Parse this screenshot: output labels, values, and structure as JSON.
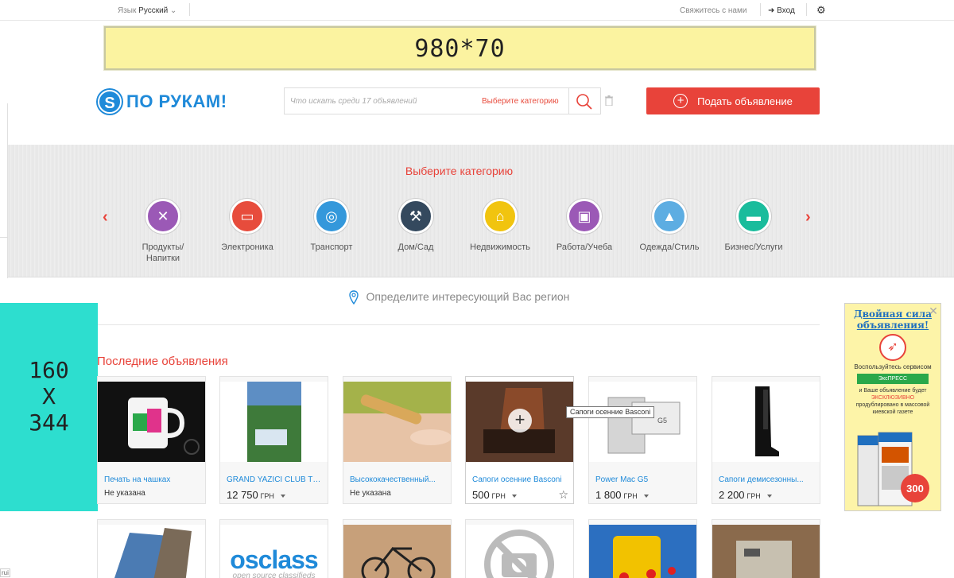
{
  "topbar": {
    "lang_label": "Язык",
    "lang_value": "Русский",
    "contact": "Свяжитесь с нами",
    "login": "Вход"
  },
  "banner_top": {
    "text": "980*70"
  },
  "header": {
    "logo_text": "ПО РУКАМ!",
    "logo_letter": "S",
    "search_placeholder": "Что искать среди 17 объявлений",
    "search_category": "Выберите категорию",
    "post_button": "Подать объявление",
    "accent": "#e8433a",
    "brand": "#1f8ad9"
  },
  "categories": {
    "title": "Выберите категорию",
    "items": [
      {
        "label": "Продукты/ Напитки",
        "color": "#9b59b6",
        "icon": "fork-knife-icon",
        "glyph": "✕"
      },
      {
        "label": "Электроника",
        "color": "#e74c3c",
        "icon": "monitor-icon",
        "glyph": "▭"
      },
      {
        "label": "Транспорт",
        "color": "#3498db",
        "icon": "wheel-icon",
        "glyph": "◎"
      },
      {
        "label": "Дом/Сад",
        "color": "#34495e",
        "icon": "tools-icon",
        "glyph": "⚒"
      },
      {
        "label": "Недвижимость",
        "color": "#f1c40f",
        "icon": "house-icon",
        "glyph": "⌂"
      },
      {
        "label": "Работа/Учеба",
        "color": "#9b59b6",
        "icon": "briefcase-icon",
        "glyph": "▣"
      },
      {
        "label": "Одежда/Стиль",
        "color": "#5dade2",
        "icon": "hanger-icon",
        "glyph": "▲"
      },
      {
        "label": "Бизнес/Услуги",
        "color": "#1abc9c",
        "icon": "card-icon",
        "glyph": "▬"
      }
    ]
  },
  "region": {
    "text": "Определите интересующий Вас регион"
  },
  "banner_left": {
    "line1": "160",
    "line2": "X",
    "line3": "344"
  },
  "banner_right": {
    "headline": "Двойная сила объявления!",
    "subtitle": "Воспользуйтесь сервисом",
    "service": "ЭксПРЕСС",
    "text1": "и Ваше объявление будет ",
    "highlight": "ЭКСКЛЮЗИВНО",
    "text2": " продублировано в массовой киевской газете"
  },
  "listings": {
    "title": "Последние объявления",
    "tooltip": "Сапоги осенние Basconi",
    "items": [
      {
        "title": "Печать на чашках",
        "price": "",
        "currency": "",
        "note": "Не указана"
      },
      {
        "title": "GRAND YAZICI CLUB TU...",
        "price": "12 750",
        "currency": "ГРН",
        "note": ""
      },
      {
        "title": "Высококачественный...",
        "price": "",
        "currency": "",
        "note": "Не указана"
      },
      {
        "title": "Сапоги осенние Basconi",
        "price": "500",
        "currency": "ГРН",
        "note": ""
      },
      {
        "title": "Power Mac G5",
        "price": "1 800",
        "currency": "ГРН",
        "note": ""
      },
      {
        "title": "Сапоги демисезонны...",
        "price": "2 200",
        "currency": "ГРН",
        "note": ""
      }
    ],
    "row2_osclass": "osclass",
    "row2_osclass_sub": "open source classifieds"
  },
  "misc": {
    "tiny": "rui"
  }
}
